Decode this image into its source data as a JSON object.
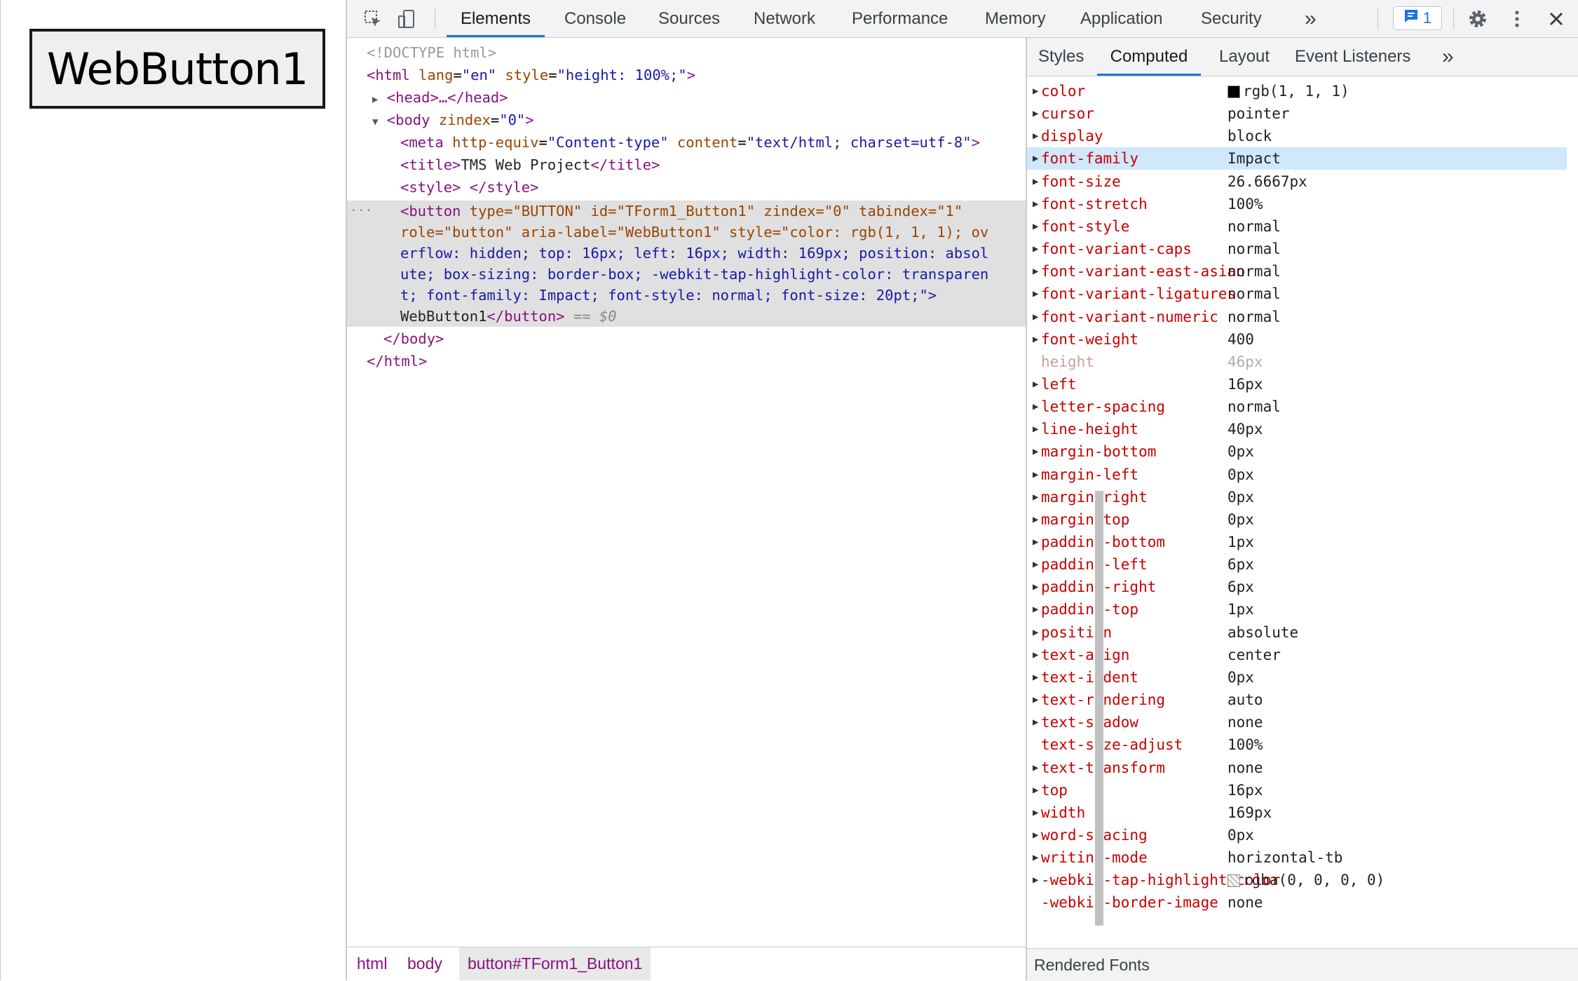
{
  "page": {
    "button_label": "WebButton1"
  },
  "toolbar": {
    "tabs": [
      "Elements",
      "Console",
      "Sources",
      "Network",
      "Performance",
      "Memory",
      "Application",
      "Security"
    ],
    "more_label": "»",
    "issues_count": "1"
  },
  "dom": {
    "doctype": "<!DOCTYPE html>",
    "html_open": "<html",
    "html_lang_attr": "lang",
    "html_lang_val": "\"en\"",
    "html_style_attr": "style",
    "html_style_val": "\"height: 100%;\"",
    "head_line": "<head>…</head>",
    "body_open": "<body",
    "body_attr": "zindex",
    "body_val": "\"0\"",
    "meta_tag": "<meta",
    "meta_attr1": "http-equiv",
    "meta_val1": "\"Content-type\"",
    "meta_attr2": "content",
    "meta_val2": "\"text/html; charset=utf-8\"",
    "title_open": "<title>",
    "title_text": "TMS Web Project",
    "title_close": "</title>",
    "style_line": "<style> </style>",
    "button_line1_tag": "<button",
    "button_line1_rest": " type=\"BUTTON\" id=\"TForm1_Button1\" zindex=\"0\" tabindex=\"1\"",
    "button_line2": "role=\"button\" aria-label=\"WebButton1\" style=\"color: rgb(1, 1, 1); ov",
    "button_line3": "erflow: hidden; top: 16px; left: 16px; width: 169px; position: absol",
    "button_line4": "ute; box-sizing: border-box; -webkit-tap-highlight-color: transparen",
    "button_line5": "t; font-family: Impact; font-style: normal; font-size: 20pt;\">",
    "button_text": "WebButton1",
    "button_close": "</button>",
    "selected_marker": " == $0",
    "body_close": "</body>",
    "html_close": "</html>",
    "ellipsis": "···"
  },
  "breadcrumb": [
    "html",
    "body",
    "button#TForm1_Button1"
  ],
  "side_tabs": [
    "Styles",
    "Computed",
    "Layout",
    "Event Listeners"
  ],
  "computed": [
    {
      "name": "color",
      "value": "rgb(1, 1, 1)",
      "swatch": "#010101"
    },
    {
      "name": "cursor",
      "value": "pointer"
    },
    {
      "name": "display",
      "value": "block"
    },
    {
      "name": "font-family",
      "value": "Impact",
      "highlight": true
    },
    {
      "name": "font-size",
      "value": "26.6667px"
    },
    {
      "name": "font-stretch",
      "value": "100%"
    },
    {
      "name": "font-style",
      "value": "normal"
    },
    {
      "name": "font-variant-caps",
      "value": "normal"
    },
    {
      "name": "font-variant-east-asian",
      "value": "normal"
    },
    {
      "name": "font-variant-ligatures",
      "value": "normal"
    },
    {
      "name": "font-variant-numeric",
      "value": "normal"
    },
    {
      "name": "font-weight",
      "value": "400"
    },
    {
      "name": "height",
      "value": "46px",
      "inherited": true,
      "no_arrow": true
    },
    {
      "name": "left",
      "value": "16px"
    },
    {
      "name": "letter-spacing",
      "value": "normal"
    },
    {
      "name": "line-height",
      "value": "40px"
    },
    {
      "name": "margin-bottom",
      "value": "0px"
    },
    {
      "name": "margin-left",
      "value": "0px"
    },
    {
      "name": "margin-right",
      "value": "0px"
    },
    {
      "name": "margin-top",
      "value": "0px"
    },
    {
      "name": "padding-bottom",
      "value": "1px"
    },
    {
      "name": "padding-left",
      "value": "6px"
    },
    {
      "name": "padding-right",
      "value": "6px"
    },
    {
      "name": "padding-top",
      "value": "1px"
    },
    {
      "name": "position",
      "value": "absolute"
    },
    {
      "name": "text-align",
      "value": "center"
    },
    {
      "name": "text-indent",
      "value": "0px"
    },
    {
      "name": "text-rendering",
      "value": "auto"
    },
    {
      "name": "text-shadow",
      "value": "none"
    },
    {
      "name": "text-size-adjust",
      "value": "100%",
      "no_arrow": true
    },
    {
      "name": "text-transform",
      "value": "none"
    },
    {
      "name": "top",
      "value": "16px"
    },
    {
      "name": "width",
      "value": "169px"
    },
    {
      "name": "word-spacing",
      "value": "0px"
    },
    {
      "name": "writing-mode",
      "value": "horizontal-tb"
    },
    {
      "name": "-webkit-tap-highlight-color",
      "value": "rgba(0, 0, 0, 0)",
      "swatch": "transparent"
    },
    {
      "name": "-webkit-border-image",
      "value": "none",
      "no_arrow": true
    }
  ],
  "rendered_fonts": {
    "title": "Rendered Fonts"
  }
}
